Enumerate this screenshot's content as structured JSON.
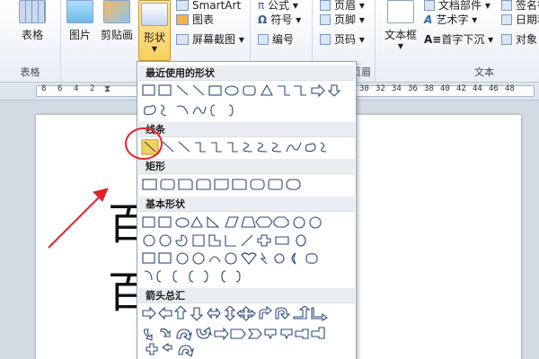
{
  "ribbon": {
    "table_label": "表格",
    "table_group_label": "表格",
    "picture_label": "图片",
    "clipart_label": "剪贴画",
    "shapes_label": "形状",
    "smartart_label": "SmartArt",
    "chart_label": "图表",
    "screenshot_label": "屏幕截图",
    "formula_label": "公式",
    "symbol_label": "符号",
    "number_label": "编号",
    "header_label": "页眉",
    "footer_label": "页脚",
    "pagenum_label": "页码",
    "header_group_label": "页眉",
    "textbox_label": "文本框",
    "docparts_label": "文档部件",
    "wordart_label": "艺术字",
    "dropcap_label": "首字下沉",
    "signature_label": "签名行",
    "datetime_label": "日期和",
    "object_label": "对象",
    "text_group_label": "文本"
  },
  "ruler": {
    "numbers_left": [
      "8",
      "6",
      "4",
      "2"
    ],
    "numbers_right": [
      "30",
      "32",
      "34",
      "36",
      "38",
      "40",
      "42",
      "44",
      "46",
      "48"
    ]
  },
  "document": {
    "chars": [
      "百",
      "百"
    ]
  },
  "shapes_menu": {
    "sections": {
      "recent": "最近使用的形状",
      "lines": "线条",
      "rectangles": "矩形",
      "basic": "基本形状",
      "arrows": "箭头总汇"
    }
  },
  "colors": {
    "accent": "#f8cf5e",
    "annotation": "#e0242a"
  }
}
